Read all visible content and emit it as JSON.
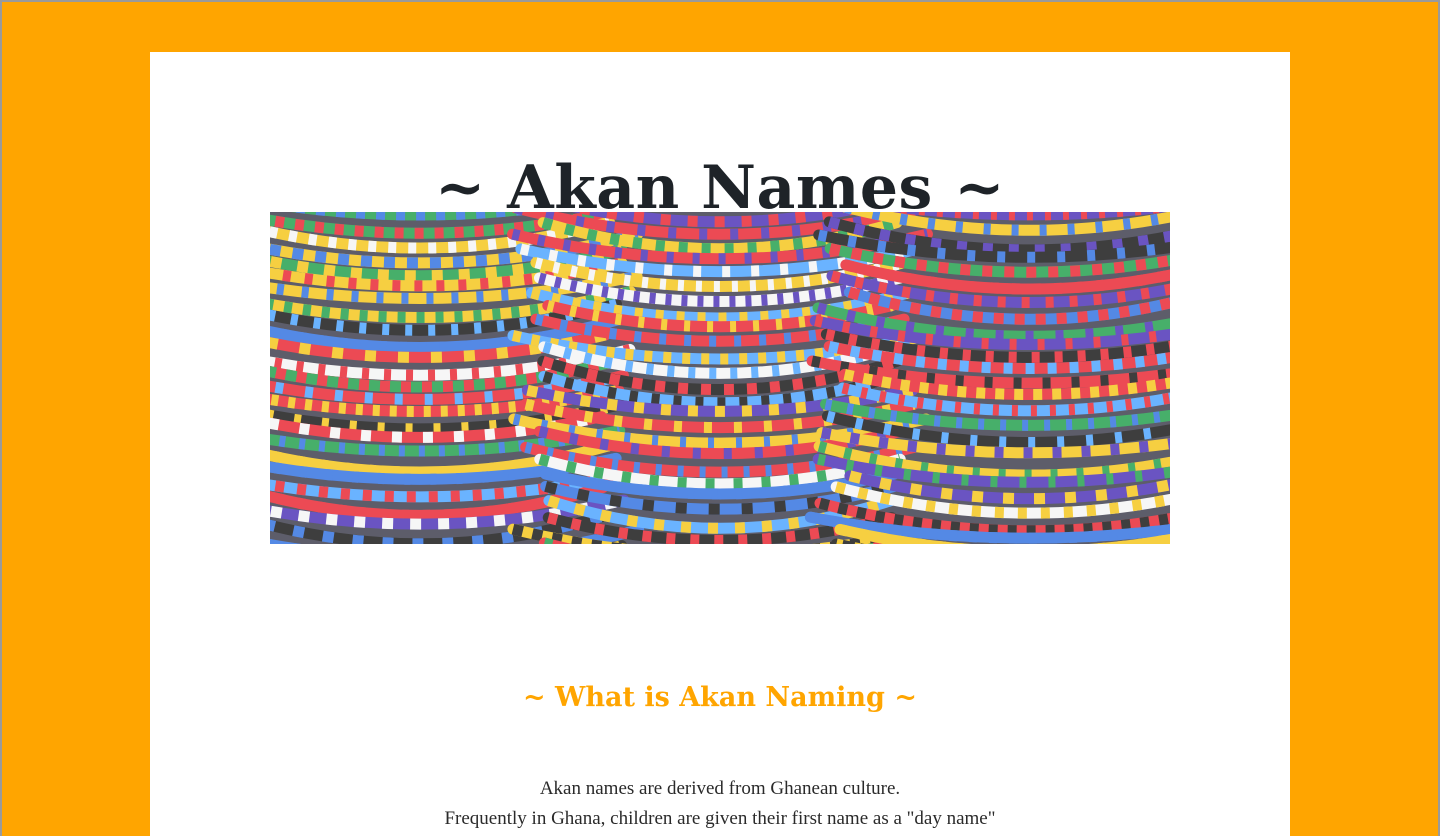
{
  "page": {
    "title": "~ Akan Names ~",
    "hero_image": {
      "alt": "Colorful beaded bracelets",
      "kind": "photo"
    },
    "section": {
      "heading": "~ What is Akan Naming ~",
      "paragraph_lines": [
        "Akan names are derived from Ghanean culture.",
        "Frequently in Ghana, children are given their first name as a \"day name\""
      ]
    }
  },
  "colors": {
    "background": "#ffa500",
    "card": "#ffffff",
    "title": "#1e2328",
    "heading_accent": "#ffa500",
    "text": "#2a2a2a"
  }
}
